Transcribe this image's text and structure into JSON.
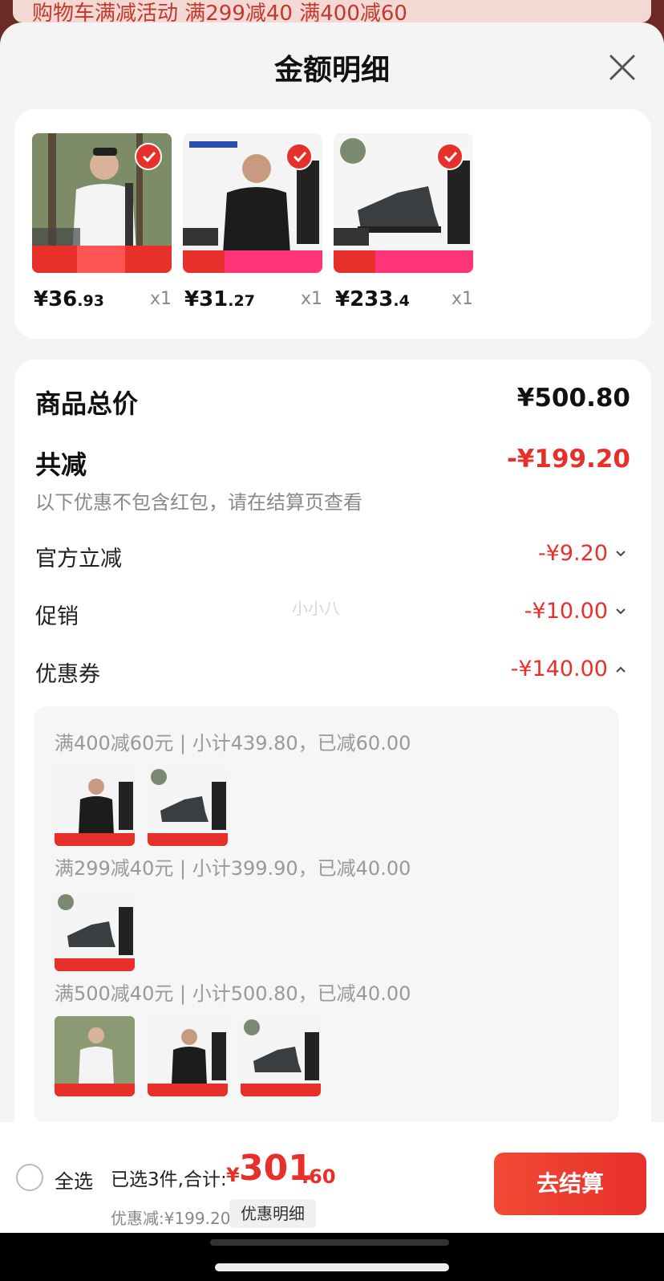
{
  "background": {
    "banner_text": "购物车满减活动 满299减40 满400减60"
  },
  "sheet": {
    "title": "金额明细"
  },
  "products": [
    {
      "price_int": "¥36",
      "price_dec": ".93",
      "qty": "x1",
      "checked": true
    },
    {
      "price_int": "¥31",
      "price_dec": ".27",
      "qty": "x1",
      "checked": true
    },
    {
      "price_int": "¥233",
      "price_dec": ".4",
      "qty": "x1",
      "checked": true
    }
  ],
  "summary": {
    "total_label": "商品总价",
    "total_value": "¥500.80",
    "discount_label": "共减",
    "discount_value": "-¥199.20",
    "note": "以下优惠不包含红包，请在结算页查看",
    "watermark": "小小八",
    "items": [
      {
        "label": "官方立减",
        "value": "-¥9.20",
        "expanded": false
      },
      {
        "label": "促销",
        "value": "-¥10.00",
        "expanded": false
      },
      {
        "label": "优惠券",
        "value": "-¥140.00",
        "expanded": true
      }
    ]
  },
  "coupons": [
    {
      "text": "满400减60元 | 小计439.80，已减60.00"
    },
    {
      "text": "满299减40元 | 小计399.90，已减40.00"
    },
    {
      "text": "满500减40元 | 小计500.80，已减40.00"
    }
  ],
  "bottom_bar": {
    "select_all": "全选",
    "selected_text": "已选3件,合计:",
    "total_yen": "¥",
    "total_int": "301",
    "total_dec": ".60",
    "discount_text": "优惠减:¥199.20",
    "detail_button": "优惠明细",
    "checkout_button": "去结算"
  },
  "colors": {
    "accent": "#e8302a",
    "muted": "#888888"
  }
}
